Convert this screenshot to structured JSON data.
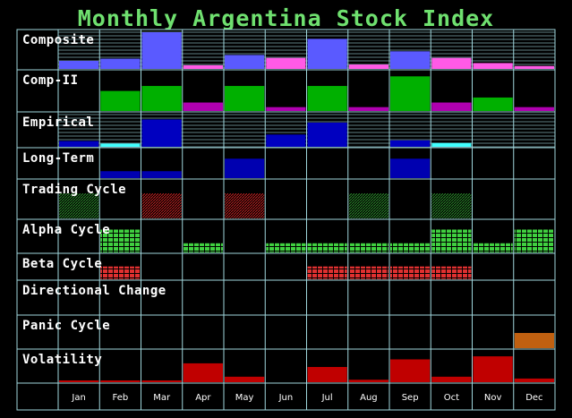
{
  "chart_data": {
    "type": "bar",
    "title": "Monthly Argentina Stock Index",
    "categories": [
      "Jan",
      "Feb",
      "Mar",
      "Apr",
      "May",
      "Jun",
      "Jul",
      "Aug",
      "Sep",
      "Oct",
      "Nov",
      "Dec"
    ],
    "panels": [
      {
        "key": "composite",
        "label": "Composite",
        "style": "hbars",
        "values": [
          0.22,
          0.28,
          1.0,
          0.1,
          0.38,
          0.3,
          0.82,
          0.12,
          0.48,
          0.3,
          0.16,
          0.08
        ],
        "colors": [
          "#5a5aff",
          "#5a5aff",
          "#5a5aff",
          "#ff5ae6",
          "#5a5aff",
          "#ff5ae6",
          "#5a5aff",
          "#ff5ae6",
          "#5a5aff",
          "#ff5ae6",
          "#ff5ae6",
          "#ff5ae6"
        ]
      },
      {
        "key": "comp2",
        "label": "Comp-II",
        "style": "bars",
        "values": [
          0,
          0.52,
          0.65,
          0.22,
          0.65,
          0.1,
          0.65,
          0.1,
          0.9,
          0.22,
          0.35,
          0.1
        ],
        "colors": [
          "#00b000",
          "#00b000",
          "#00b000",
          "#b000b0",
          "#00b000",
          "#b000b0",
          "#00b000",
          "#b000b0",
          "#00b000",
          "#b000b0",
          "#00b000",
          "#b000b0"
        ]
      },
      {
        "key": "empirical",
        "label": "Empirical",
        "style": "hbars",
        "values": [
          0.18,
          0.1,
          0.85,
          0,
          0,
          0.38,
          0.75,
          0,
          0.2,
          0.12,
          0,
          0
        ],
        "colors": [
          "#0000c0",
          "#40ffff",
          "#0000c0",
          "#0000c0",
          "#0000c0",
          "#0000c0",
          "#0000c0",
          "#0000c0",
          "#0000c0",
          "#40ffff",
          "#0000c0",
          "#0000c0"
        ]
      },
      {
        "key": "longterm",
        "label": "Long-Term",
        "style": "bars",
        "values": [
          0,
          0.25,
          0.25,
          0,
          0.7,
          0,
          0,
          0,
          0.7,
          0,
          0,
          0
        ],
        "colors": [
          "#0000b0",
          "#0000b0",
          "#0000b0",
          "#0000b0",
          "#0000b0",
          "#0000b0",
          "#0000b0",
          "#0000b0",
          "#0000b0",
          "#0000b0",
          "#0000b0",
          "#0000b0"
        ]
      },
      {
        "key": "trading",
        "label": "Trading Cycle",
        "style": "hatch",
        "values": [
          1,
          0,
          1,
          0,
          1,
          0,
          0,
          1,
          0,
          1,
          0,
          0
        ],
        "colors": [
          "#2a8a2a",
          "#000000",
          "#c02020",
          "#000000",
          "#c02020",
          "#000000",
          "#000000",
          "#2a8a2a",
          "#000000",
          "#2a8a2a",
          "#000000",
          "#000000"
        ]
      },
      {
        "key": "alpha",
        "label": "Alpha Cycle",
        "style": "grid",
        "values": [
          0,
          0.75,
          0,
          0.3,
          0,
          0.3,
          0.3,
          0.3,
          0.3,
          0.75,
          0.3,
          0.75
        ],
        "colors": [
          "#40d040",
          "#40d040",
          "#40d040",
          "#40d040",
          "#40d040",
          "#40d040",
          "#40d040",
          "#40d040",
          "#40d040",
          "#40d040",
          "#40d040",
          "#40d040"
        ]
      },
      {
        "key": "beta",
        "label": "Beta Cycle",
        "style": "grid",
        "values": [
          0,
          0.55,
          0,
          0,
          0,
          0,
          0.55,
          0.55,
          0.55,
          0.55,
          0,
          0
        ],
        "colors": [
          "#e03030",
          "#e03030",
          "#e03030",
          "#e03030",
          "#e03030",
          "#e03030",
          "#e03030",
          "#e03030",
          "#e03030",
          "#e03030",
          "#e03030",
          "#e03030"
        ]
      },
      {
        "key": "directional",
        "label": "Directional Change",
        "style": "bars",
        "values": [
          0,
          0,
          0,
          0,
          0,
          0,
          0,
          0,
          0,
          0,
          0,
          0
        ],
        "colors": [
          "#000000",
          "#000000",
          "#000000",
          "#000000",
          "#000000",
          "#000000",
          "#000000",
          "#000000",
          "#000000",
          "#000000",
          "#000000",
          "#000000"
        ]
      },
      {
        "key": "panic",
        "label": "Panic Cycle",
        "style": "bars",
        "values": [
          0,
          0,
          0,
          0,
          0,
          0,
          0,
          0,
          0,
          0,
          0,
          0.5
        ],
        "colors": [
          "#c06010",
          "#c06010",
          "#c06010",
          "#c06010",
          "#c06010",
          "#c06010",
          "#c06010",
          "#c06010",
          "#c06010",
          "#c06010",
          "#c06010",
          "#c06010"
        ]
      },
      {
        "key": "volatility",
        "label": "Volatility",
        "style": "bars",
        "values": [
          0.04,
          0.04,
          0.04,
          0.62,
          0.18,
          0,
          0.5,
          0.08,
          0.75,
          0.18,
          0.85,
          0.12
        ],
        "colors": [
          "#c00000",
          "#c00000",
          "#c00000",
          "#c00000",
          "#c00000",
          "#c00000",
          "#c00000",
          "#c00000",
          "#c00000",
          "#c00000",
          "#c00000",
          "#c00000"
        ]
      }
    ]
  },
  "colors": {
    "grid": "#9fd6dc",
    "title": "#6fe06f",
    "background": "#000000"
  }
}
